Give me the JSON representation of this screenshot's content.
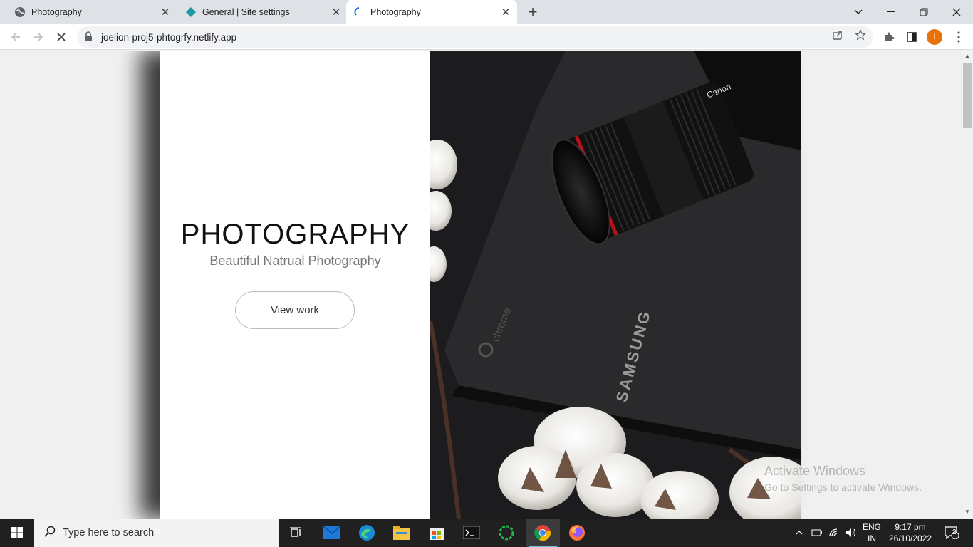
{
  "browser": {
    "tabs": [
      {
        "title": "Photography",
        "favicon": "globe-icon",
        "active": false
      },
      {
        "title": "General | Site settings",
        "favicon": "netlify-diamond-icon",
        "active": false
      },
      {
        "title": "Photography",
        "favicon": "loading-spinner-icon",
        "active": true
      }
    ],
    "url": "joelion-proj5-phtogrfy.netlify.app",
    "profile_initial": "I",
    "profile_color": "#e8710a"
  },
  "site": {
    "title": "PHOTOGRAPHY",
    "subtitle": "Beautiful Natrual Photography",
    "button": "View work",
    "image_text": {
      "lens_brand": "Canon",
      "laptop_brand": "SAMSUNG",
      "laptop_os": "chrome"
    }
  },
  "watermark": {
    "line1": "Activate Windows",
    "line2": "Go to Settings to activate Windows."
  },
  "taskbar": {
    "search_placeholder": "Type here to search",
    "language": "ENG",
    "region": "IN",
    "time": "9:17 pm",
    "date": "26/10/2022",
    "notifications": "2",
    "apps": [
      "task-view-icon",
      "mail-icon",
      "edge-icon",
      "file-explorer-icon",
      "microsoft-store-icon",
      "terminal-icon",
      "green-ring-app-icon",
      "chrome-icon",
      "firefox-icon"
    ]
  }
}
